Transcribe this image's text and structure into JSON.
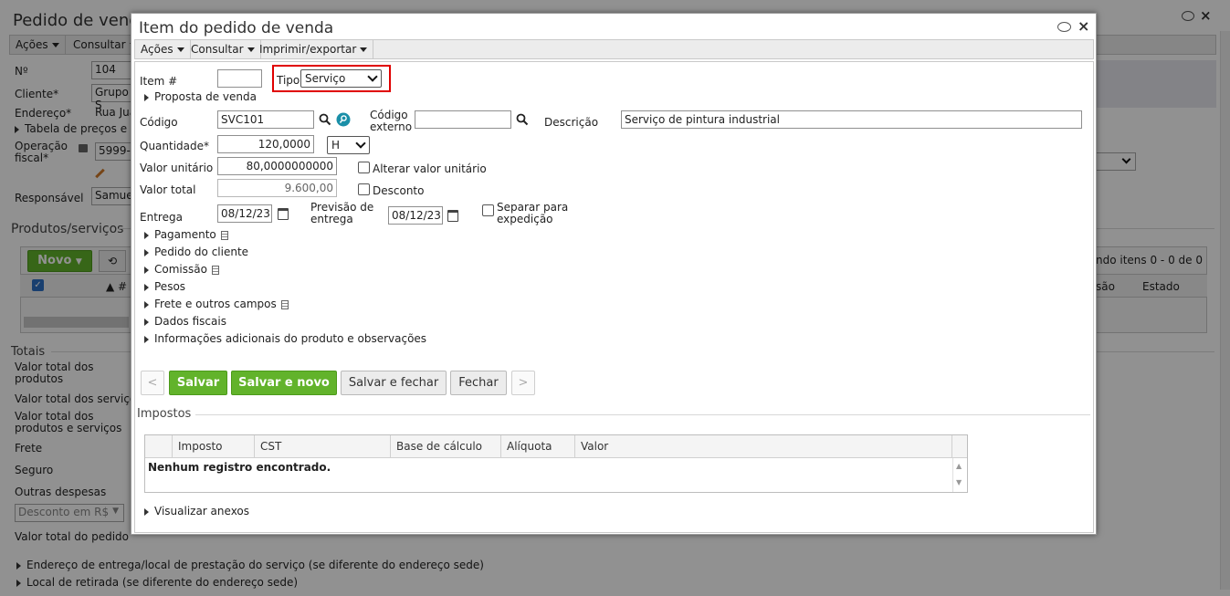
{
  "background": {
    "title": "Pedido de venda",
    "menu": [
      "Ações",
      "Consultar"
    ],
    "fields": {
      "numero_label": "Nº",
      "numero_value": "104",
      "cliente_label": "Cliente*",
      "cliente_value": "Grupo S",
      "endereco_label": "Endereço*",
      "endereco_value": "Rua Jua",
      "tabela_precos": "Tabela de preços e re",
      "operacao_label": "Operação fiscal*",
      "operacao_value": "5999-",
      "responsavel_label": "Responsável",
      "responsavel_value": "Samuel"
    },
    "produtos_title": "Produtos/serviços",
    "novo_button": "Novo",
    "grid_status": "ndo itens 0 - 0 de 0",
    "grid_headers": [
      "#",
      "são",
      "Estado"
    ],
    "totais_title": "Totais",
    "totais": [
      "Valor total dos produtos",
      "Valor total dos serviços",
      "Valor total dos produtos e serviços",
      "Frete",
      "Seguro",
      "Outras despesas"
    ],
    "desconto_select": "Desconto em R$",
    "valor_total_pedido": "Valor total do pedido",
    "endereco_entrega": "Endereço de entrega/local de prestação do serviço (se diferente do endereço sede)",
    "local_retirada": "Local de retirada (se diferente do endereço sede)"
  },
  "modal": {
    "title": "Item do pedido de venda",
    "menu": [
      "Ações",
      "Consultar",
      "Imprimir/exportar"
    ],
    "item_label": "Item #",
    "item_value": "",
    "tipo_label": "Tipo",
    "tipo_value": "Serviço",
    "proposta": "Proposta de venda",
    "codigo_label": "Código",
    "codigo_value": "SVC101",
    "codigo_externo_label_1": "Código",
    "codigo_externo_label_2": "externo",
    "codigo_externo_value": "",
    "descricao_label": "Descrição",
    "descricao_value": "Serviço de pintura industrial",
    "quantidade_label": "Quantidade*",
    "quantidade_value": "120,0000",
    "unidade_value": "H",
    "valor_unitario_label": "Valor unitário",
    "valor_unitario_value": "80,0000000000",
    "alterar_valor_label": "Alterar valor unitário",
    "valor_total_label": "Valor total",
    "valor_total_value": "9.600,00",
    "desconto_label": "Desconto",
    "entrega_label": "Entrega",
    "entrega_value": "08/12/23",
    "previsao_label_1": "Previsão de",
    "previsao_label_2": "entrega",
    "previsao_value": "08/12/23",
    "separar_label_1": "Separar para",
    "separar_label_2": "expedição",
    "sections": [
      "Pagamento",
      "Pedido do cliente",
      "Comissão",
      "Pesos",
      "Frete e outros campos",
      "Dados fiscais",
      "Informações adicionais do produto e observações"
    ],
    "buttons": {
      "prev": "<",
      "salvar": "Salvar",
      "salvar_novo": "Salvar e novo",
      "salvar_fechar": "Salvar e fechar",
      "fechar": "Fechar",
      "next": ">"
    },
    "impostos_title": "Impostos",
    "impostos_headers": [
      "Imposto",
      "CST",
      "Base de cálculo",
      "Alíquota",
      "Valor"
    ],
    "impostos_empty": "Nenhum registro encontrado.",
    "anexos": "Visualizar anexos"
  }
}
